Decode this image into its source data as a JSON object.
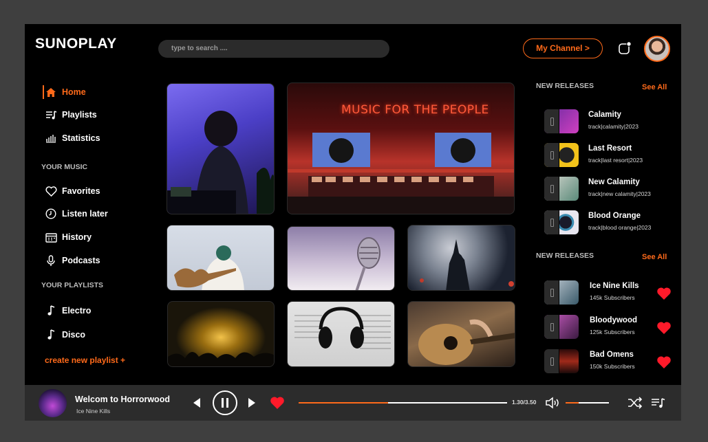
{
  "app": {
    "logo": "SUNOPLAY"
  },
  "header": {
    "search_placeholder": "type to search ....",
    "channel_label": "My Channel >"
  },
  "sidebar": {
    "main": [
      {
        "label": "Home",
        "icon": "home-icon",
        "active": true
      },
      {
        "label": "Playlists",
        "icon": "playlist-icon"
      },
      {
        "label": "Statistics",
        "icon": "statistics-icon"
      }
    ],
    "your_music_label": "YOUR MUSIC",
    "your_music": [
      {
        "label": "Favorites",
        "icon": "heart-outline-icon"
      },
      {
        "label": "Listen later",
        "icon": "clock-icon"
      },
      {
        "label": "History",
        "icon": "calendar-icon"
      },
      {
        "label": "Podcasts",
        "icon": "microphone-icon"
      }
    ],
    "your_playlists_label": "YOUR PLAYLISTS",
    "your_playlists": [
      {
        "label": "Electro",
        "icon": "music-note-icon"
      },
      {
        "label": "Disco",
        "icon": "music-note-icon"
      }
    ],
    "create_label": "create new playlist +"
  },
  "grid": {
    "neon_sign": "MUSIC FOR THE PEOPLE"
  },
  "releases": {
    "heading": "NEW RELEASES",
    "see_all": "See All",
    "items": [
      {
        "title": "Calamity",
        "sub": "track|calamity|2023"
      },
      {
        "title": "Last Resort",
        "sub": "track|last resort|2023"
      },
      {
        "title": "New Calamity",
        "sub": "track|new calamity|2023"
      },
      {
        "title": "Blood Orange",
        "sub": "track|blood orange|2023"
      }
    ]
  },
  "artists": {
    "heading": "NEW RELEASES",
    "see_all": "See All",
    "items": [
      {
        "title": "Ice Nine Kills",
        "sub": "145k Subscribers"
      },
      {
        "title": "Bloodywood",
        "sub": "125k Subscribers"
      },
      {
        "title": "Bad Omens",
        "sub": "150k Subscribers"
      }
    ]
  },
  "player": {
    "title": "Welcom to Horrorwood",
    "artist": "Ice Nine Kills",
    "time": "1.30/3.50",
    "progress": 0.43,
    "volume": 0.3
  },
  "colors": {
    "accent": "#ff6a1a",
    "heart": "#ff1a2a",
    "background": "#000000",
    "player_bg": "#2c2c2c"
  }
}
